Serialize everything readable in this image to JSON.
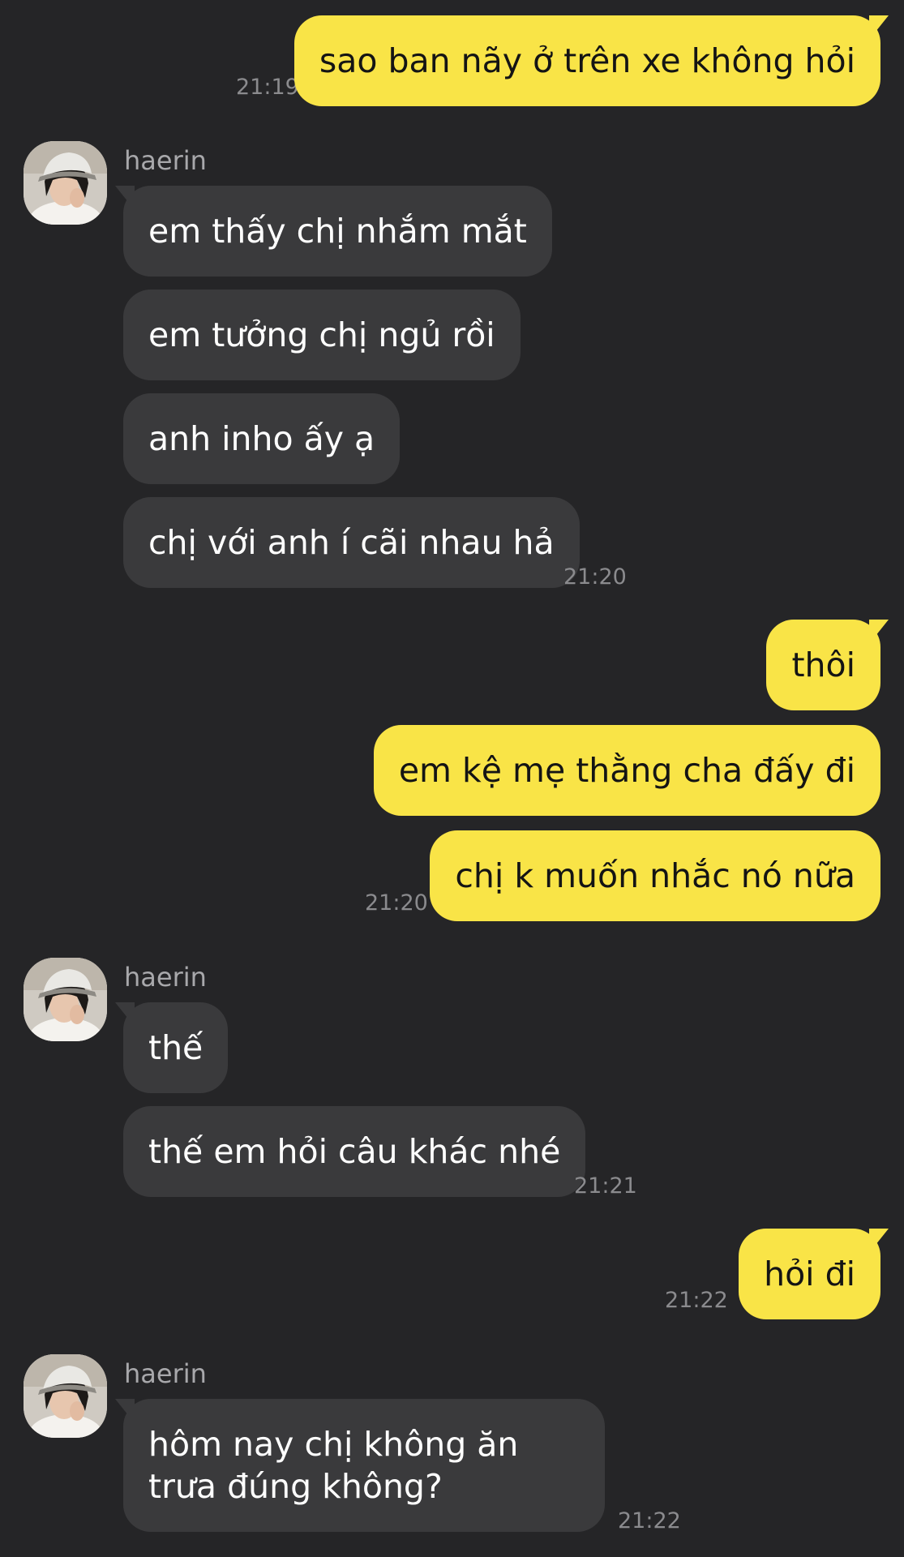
{
  "contact": {
    "name": "haerin",
    "avatar_icon": "profile-photo"
  },
  "colors": {
    "background": "#252527",
    "outgoing_bubble": "#f9e447",
    "incoming_bubble": "#3a3a3c",
    "timestamp": "#8b8b8e"
  },
  "messages": {
    "m1": {
      "text": "sao ban nãy ở trên xe không hỏi",
      "time": "21:19"
    },
    "m2": {
      "text": "em thấy chị nhắm mắt"
    },
    "m3": {
      "text": "em tưởng chị ngủ rồi"
    },
    "m4": {
      "text": "anh inho ấy ạ"
    },
    "m5": {
      "text": "chị với anh í cãi nhau hả",
      "time": "21:20"
    },
    "m6": {
      "text": "thôi"
    },
    "m7": {
      "text": "em kệ mẹ thằng cha đấy đi"
    },
    "m8": {
      "text": "chị k muốn nhắc nó nữa",
      "time": "21:20"
    },
    "m9": {
      "text": "thế"
    },
    "m10": {
      "text": "thế em hỏi câu khác nhé",
      "time": "21:21"
    },
    "m11": {
      "text": "hỏi đi",
      "time": "21:22"
    },
    "m12": {
      "text": "hôm nay chị không ăn trưa đúng không?",
      "time": "21:22"
    }
  }
}
